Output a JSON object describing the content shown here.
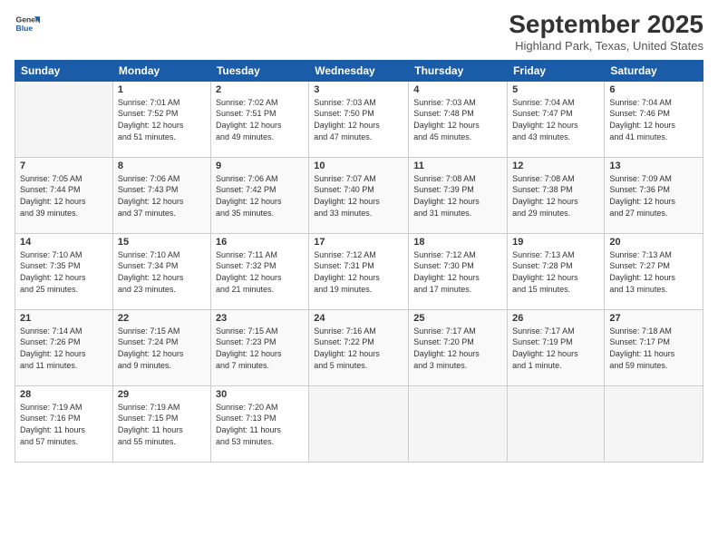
{
  "header": {
    "logo_line1": "General",
    "logo_line2": "Blue",
    "month": "September 2025",
    "location": "Highland Park, Texas, United States"
  },
  "days_of_week": [
    "Sunday",
    "Monday",
    "Tuesday",
    "Wednesday",
    "Thursday",
    "Friday",
    "Saturday"
  ],
  "weeks": [
    [
      {
        "num": "",
        "info": ""
      },
      {
        "num": "1",
        "info": "Sunrise: 7:01 AM\nSunset: 7:52 PM\nDaylight: 12 hours\nand 51 minutes."
      },
      {
        "num": "2",
        "info": "Sunrise: 7:02 AM\nSunset: 7:51 PM\nDaylight: 12 hours\nand 49 minutes."
      },
      {
        "num": "3",
        "info": "Sunrise: 7:03 AM\nSunset: 7:50 PM\nDaylight: 12 hours\nand 47 minutes."
      },
      {
        "num": "4",
        "info": "Sunrise: 7:03 AM\nSunset: 7:48 PM\nDaylight: 12 hours\nand 45 minutes."
      },
      {
        "num": "5",
        "info": "Sunrise: 7:04 AM\nSunset: 7:47 PM\nDaylight: 12 hours\nand 43 minutes."
      },
      {
        "num": "6",
        "info": "Sunrise: 7:04 AM\nSunset: 7:46 PM\nDaylight: 12 hours\nand 41 minutes."
      }
    ],
    [
      {
        "num": "7",
        "info": "Sunrise: 7:05 AM\nSunset: 7:44 PM\nDaylight: 12 hours\nand 39 minutes."
      },
      {
        "num": "8",
        "info": "Sunrise: 7:06 AM\nSunset: 7:43 PM\nDaylight: 12 hours\nand 37 minutes."
      },
      {
        "num": "9",
        "info": "Sunrise: 7:06 AM\nSunset: 7:42 PM\nDaylight: 12 hours\nand 35 minutes."
      },
      {
        "num": "10",
        "info": "Sunrise: 7:07 AM\nSunset: 7:40 PM\nDaylight: 12 hours\nand 33 minutes."
      },
      {
        "num": "11",
        "info": "Sunrise: 7:08 AM\nSunset: 7:39 PM\nDaylight: 12 hours\nand 31 minutes."
      },
      {
        "num": "12",
        "info": "Sunrise: 7:08 AM\nSunset: 7:38 PM\nDaylight: 12 hours\nand 29 minutes."
      },
      {
        "num": "13",
        "info": "Sunrise: 7:09 AM\nSunset: 7:36 PM\nDaylight: 12 hours\nand 27 minutes."
      }
    ],
    [
      {
        "num": "14",
        "info": "Sunrise: 7:10 AM\nSunset: 7:35 PM\nDaylight: 12 hours\nand 25 minutes."
      },
      {
        "num": "15",
        "info": "Sunrise: 7:10 AM\nSunset: 7:34 PM\nDaylight: 12 hours\nand 23 minutes."
      },
      {
        "num": "16",
        "info": "Sunrise: 7:11 AM\nSunset: 7:32 PM\nDaylight: 12 hours\nand 21 minutes."
      },
      {
        "num": "17",
        "info": "Sunrise: 7:12 AM\nSunset: 7:31 PM\nDaylight: 12 hours\nand 19 minutes."
      },
      {
        "num": "18",
        "info": "Sunrise: 7:12 AM\nSunset: 7:30 PM\nDaylight: 12 hours\nand 17 minutes."
      },
      {
        "num": "19",
        "info": "Sunrise: 7:13 AM\nSunset: 7:28 PM\nDaylight: 12 hours\nand 15 minutes."
      },
      {
        "num": "20",
        "info": "Sunrise: 7:13 AM\nSunset: 7:27 PM\nDaylight: 12 hours\nand 13 minutes."
      }
    ],
    [
      {
        "num": "21",
        "info": "Sunrise: 7:14 AM\nSunset: 7:26 PM\nDaylight: 12 hours\nand 11 minutes."
      },
      {
        "num": "22",
        "info": "Sunrise: 7:15 AM\nSunset: 7:24 PM\nDaylight: 12 hours\nand 9 minutes."
      },
      {
        "num": "23",
        "info": "Sunrise: 7:15 AM\nSunset: 7:23 PM\nDaylight: 12 hours\nand 7 minutes."
      },
      {
        "num": "24",
        "info": "Sunrise: 7:16 AM\nSunset: 7:22 PM\nDaylight: 12 hours\nand 5 minutes."
      },
      {
        "num": "25",
        "info": "Sunrise: 7:17 AM\nSunset: 7:20 PM\nDaylight: 12 hours\nand 3 minutes."
      },
      {
        "num": "26",
        "info": "Sunrise: 7:17 AM\nSunset: 7:19 PM\nDaylight: 12 hours\nand 1 minute."
      },
      {
        "num": "27",
        "info": "Sunrise: 7:18 AM\nSunset: 7:17 PM\nDaylight: 11 hours\nand 59 minutes."
      }
    ],
    [
      {
        "num": "28",
        "info": "Sunrise: 7:19 AM\nSunset: 7:16 PM\nDaylight: 11 hours\nand 57 minutes."
      },
      {
        "num": "29",
        "info": "Sunrise: 7:19 AM\nSunset: 7:15 PM\nDaylight: 11 hours\nand 55 minutes."
      },
      {
        "num": "30",
        "info": "Sunrise: 7:20 AM\nSunset: 7:13 PM\nDaylight: 11 hours\nand 53 minutes."
      },
      {
        "num": "",
        "info": ""
      },
      {
        "num": "",
        "info": ""
      },
      {
        "num": "",
        "info": ""
      },
      {
        "num": "",
        "info": ""
      }
    ]
  ]
}
